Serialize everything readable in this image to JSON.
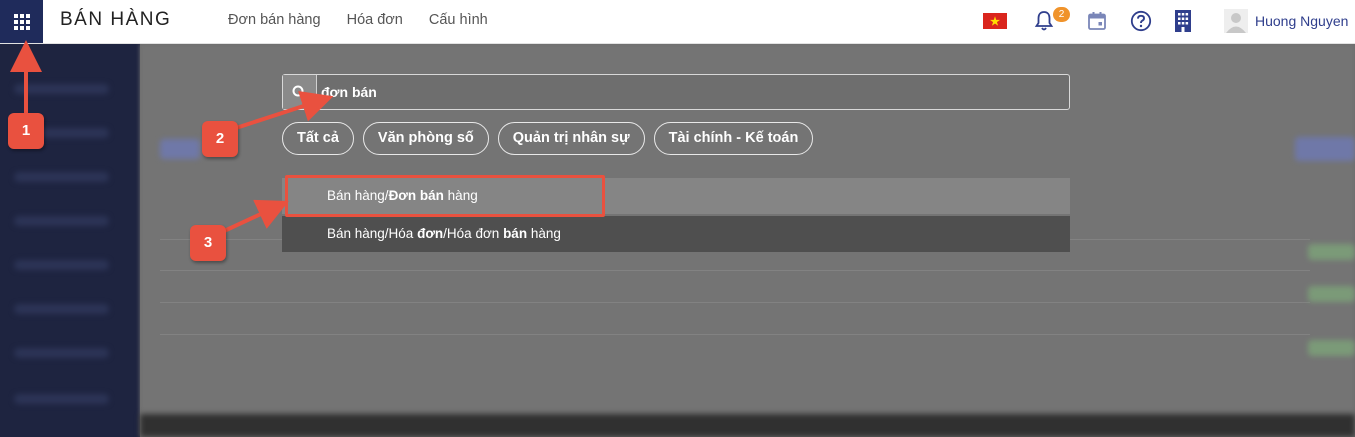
{
  "topbar": {
    "app_title": "BÁN HÀNG",
    "nav": [
      "Đơn bán hàng",
      "Hóa đơn",
      "Cấu hình"
    ],
    "notification_count": "2",
    "user_name": "Huong Nguyen"
  },
  "search": {
    "value": "đơn bán",
    "placeholder": ""
  },
  "filters": [
    "Tất cả",
    "Văn phòng số",
    "Quản trị nhân sự",
    "Tài chính - Kế toán"
  ],
  "results": [
    {
      "prefix": "Bán hàng/",
      "bold1": "Đơn bán",
      "mid": " hàng",
      "bold2": "",
      "suffix": ""
    },
    {
      "prefix": "Bán hàng/Hóa ",
      "bold1": "đơn",
      "mid": "/Hóa đơn ",
      "bold2": "bán",
      "suffix": " hàng"
    }
  ],
  "annotations": [
    "1",
    "2",
    "3"
  ],
  "colors": {
    "apps_button": "#1f2b5b",
    "annotation": "#e9513f",
    "badge": "#f0932b",
    "user_name": "#2f3e8c"
  }
}
